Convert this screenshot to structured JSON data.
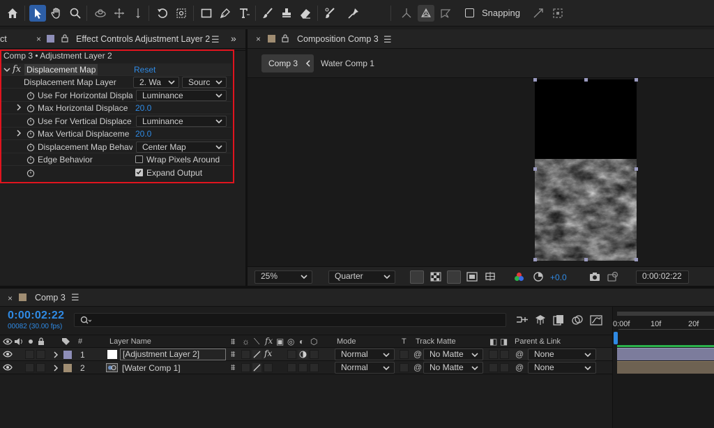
{
  "toolbar": {
    "snapping_label": "Snapping",
    "snapping_checked": false
  },
  "effect_controls": {
    "left_tab_stub": "ct",
    "tab_title": "Effect Controls Adjustment Layer 2",
    "breadcrumb": "Comp 3 • Adjustment Layer 2",
    "effect": {
      "fx": "fx",
      "name": "Displacement Map",
      "reset": "Reset"
    },
    "rows": {
      "map_layer": {
        "label": "Displacement Map Layer",
        "layer_value": "2. Wa",
        "source_value": "Sourc"
      },
      "use_h": {
        "label": "Use For Horizontal Displa",
        "value": "Luminance"
      },
      "max_h": {
        "label": "Max Horizontal Displace",
        "value": "20.0"
      },
      "use_v": {
        "label": "Use For Vertical Displace",
        "value": "Luminance"
      },
      "max_v": {
        "label": "Max Vertical Displaceme",
        "value": "20.0"
      },
      "behavior": {
        "label": "Displacement Map Behav",
        "value": "Center Map"
      },
      "edge": {
        "label": "Edge Behavior",
        "wrap_label": "Wrap Pixels Around",
        "wrap_checked": false
      },
      "expand": {
        "expand_label": "Expand Output",
        "expand_checked": true
      }
    }
  },
  "composition": {
    "tab_title": "Composition Comp 3",
    "flow": {
      "current": "Comp 3",
      "next": "Water Comp 1"
    },
    "footer": {
      "zoom": "25%",
      "resolution": "Quarter",
      "exposure": "+0.0",
      "timecode": "0:00:02:22"
    }
  },
  "timeline": {
    "tab_title": "Comp 3",
    "timecode": "0:00:02:22",
    "frame_info": "00082 (30.00 fps)",
    "search_placeholder": "",
    "columns": {
      "num": "#",
      "layer_name": "Layer Name",
      "mode": "Mode",
      "t": "T",
      "track_matte": "Track Matte",
      "parent": "Parent & Link"
    },
    "ruler": [
      "0:00f",
      "10f",
      "20f"
    ],
    "layers": [
      {
        "num": "1",
        "name": "[Adjustment Layer 2]",
        "mode": "Normal",
        "matte": "No Matte",
        "parent": "None",
        "color": "#8e8eb8"
      },
      {
        "num": "2",
        "name": "[Water Comp 1]",
        "mode": "Normal",
        "matte": "No Matte",
        "parent": "None",
        "color": "#a08d72"
      }
    ]
  },
  "colors": {
    "accent_blue": "#2f8ae4",
    "highlight_red": "#e0141e",
    "work_area_green": "#2bb24c"
  }
}
